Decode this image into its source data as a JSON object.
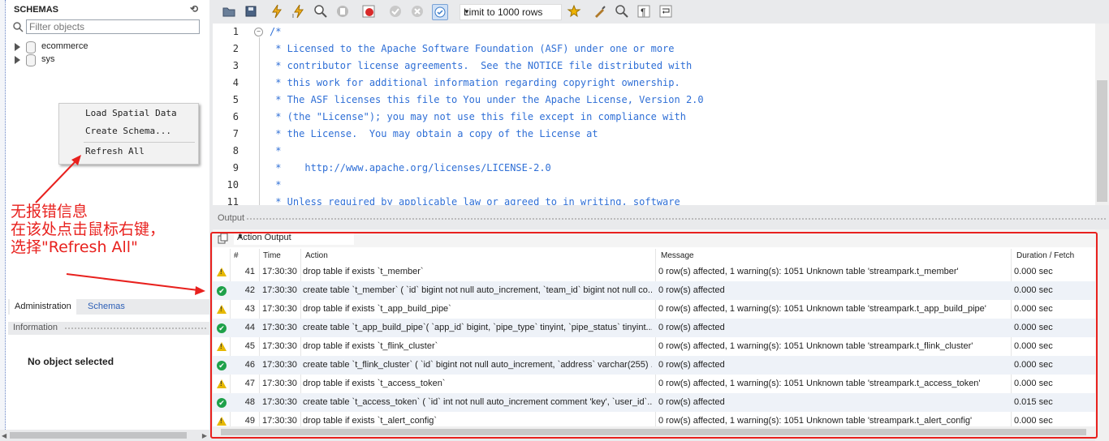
{
  "sidebar": {
    "title": "SCHEMAS",
    "filter_placeholder": "Filter objects",
    "tree": [
      {
        "label": "ecommerce"
      },
      {
        "label": "sys"
      }
    ],
    "context_menu": [
      "Load Spatial Data",
      "Create Schema...",
      "Refresh All"
    ],
    "annotation": [
      "无报错信息",
      "在该处点击鼠标右键，",
      "选择\"Refresh All\""
    ],
    "annotation_color": "#e8211e",
    "tabs": [
      "Administration",
      "Schemas"
    ],
    "info_title": "Information",
    "no_object": "No object selected"
  },
  "toolbar": {
    "limit_label": "Limit to 1000 rows",
    "icons": [
      "open-folder-icon",
      "save-icon",
      "execute-icon",
      "execute-current-icon",
      "explain-icon",
      "stop-icon",
      "toggle-error-icon",
      "commit-icon",
      "rollback-icon",
      "autocommit-icon",
      "favorite-snippet-icon",
      "beautify-icon",
      "find-icon",
      "invisible-chars-icon",
      "wrap-icon"
    ]
  },
  "editor": {
    "lines": [
      {
        "n": "1",
        "text": "/*"
      },
      {
        "n": "2",
        "text": " * Licensed to the Apache Software Foundation (ASF) under one or more"
      },
      {
        "n": "3",
        "text": " * contributor license agreements.  See the NOTICE file distributed with"
      },
      {
        "n": "4",
        "text": " * this work for additional information regarding copyright ownership."
      },
      {
        "n": "5",
        "text": " * The ASF licenses this file to You under the Apache License, Version 2.0"
      },
      {
        "n": "6",
        "text": " * (the \"License\"); you may not use this file except in compliance with"
      },
      {
        "n": "7",
        "text": " * the License.  You may obtain a copy of the License at"
      },
      {
        "n": "8",
        "text": " *"
      },
      {
        "n": "9",
        "text": " *    http://www.apache.org/licenses/LICENSE-2.0"
      },
      {
        "n": "10",
        "text": " *"
      },
      {
        "n": "11",
        "text": " * Unless required by applicable law or agreed to in writing, software"
      }
    ]
  },
  "output": {
    "title": "Output",
    "selector": "Action Output",
    "columns": [
      "#",
      "Time",
      "Action",
      "Message",
      "Duration / Fetch"
    ],
    "rows": [
      {
        "status": "warning",
        "num": "41",
        "time": "17:30:30",
        "action": "drop table if exists `t_member`",
        "message": "0 row(s) affected, 1 warning(s): 1051 Unknown table 'streampark.t_member'",
        "duration": "0.000 sec"
      },
      {
        "status": "ok",
        "num": "42",
        "time": "17:30:30",
        "action": "create table `t_member` (   `id` bigint not null auto_increment,   `team_id` bigint not null co...",
        "message": "0 row(s) affected",
        "duration": "0.000 sec"
      },
      {
        "status": "warning",
        "num": "43",
        "time": "17:30:30",
        "action": "drop table if exists `t_app_build_pipe`",
        "message": "0 row(s) affected, 1 warning(s): 1051 Unknown table 'streampark.t_app_build_pipe'",
        "duration": "0.000 sec"
      },
      {
        "status": "ok",
        "num": "44",
        "time": "17:30:30",
        "action": "create table `t_app_build_pipe`(   `app_id` bigint,   `pipe_type` tinyint,   `pipe_status` tinyint...",
        "message": "0 row(s) affected",
        "duration": "0.000 sec"
      },
      {
        "status": "warning",
        "num": "45",
        "time": "17:30:30",
        "action": "drop table if exists `t_flink_cluster`",
        "message": "0 row(s) affected, 1 warning(s): 1051 Unknown table 'streampark.t_flink_cluster'",
        "duration": "0.000 sec"
      },
      {
        "status": "ok",
        "num": "46",
        "time": "17:30:30",
        "action": "create table `t_flink_cluster` (   `id` bigint not null auto_increment,   `address` varchar(255) ...",
        "message": "0 row(s) affected",
        "duration": "0.000 sec"
      },
      {
        "status": "warning",
        "num": "47",
        "time": "17:30:30",
        "action": "drop table if exists `t_access_token`",
        "message": "0 row(s) affected, 1 warning(s): 1051 Unknown table 'streampark.t_access_token'",
        "duration": "0.000 sec"
      },
      {
        "status": "ok",
        "num": "48",
        "time": "17:30:30",
        "action": "create table `t_access_token` (   `id` int not null auto_increment comment 'key',   `user_id`...",
        "message": "0 row(s) affected",
        "duration": "0.015 sec"
      },
      {
        "status": "warning",
        "num": "49",
        "time": "17:30:30",
        "action": "drop table if exists `t_alert_config`",
        "message": "0 row(s) affected, 1 warning(s): 1051 Unknown table 'streampark.t_alert_config'",
        "duration": "0.000 sec"
      }
    ]
  }
}
